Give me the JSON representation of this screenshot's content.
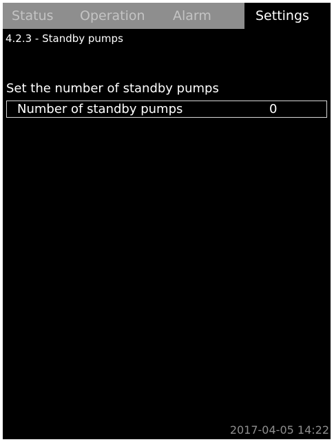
{
  "tabs": {
    "status": "Status",
    "operation": "Operation",
    "alarm": "Alarm",
    "settings": "Settings",
    "active": "Settings"
  },
  "breadcrumb": "4.2.3 - Standby pumps",
  "section_title": "Set the number of standby pumps",
  "parameter": {
    "label": "Number of standby pumps",
    "value": "0"
  },
  "footer": {
    "timestamp": "2017-04-05 14:22"
  },
  "colors": {
    "screen_background": "#000000",
    "tab_inactive_background": "#8e8e8e",
    "tab_inactive_text": "#c4c4c4",
    "text": "#ffffff"
  }
}
